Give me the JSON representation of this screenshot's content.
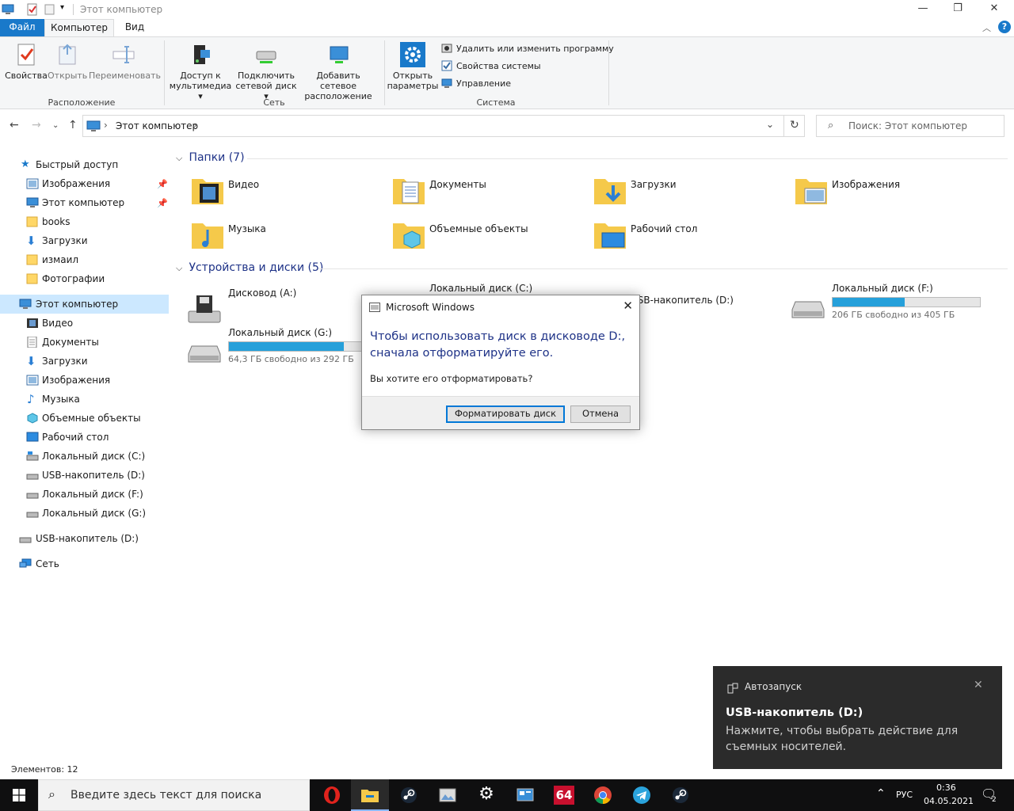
{
  "window": {
    "title": "Этот компьютер"
  },
  "ribbon": {
    "tabs": {
      "file": "Файл",
      "computer": "Компьютер",
      "view": "Вид"
    },
    "location": {
      "group_label": "Расположение",
      "properties": "Свойства",
      "open": "Открыть",
      "rename": "Переименовать"
    },
    "network": {
      "group_label": "Сеть",
      "media_line1": "Доступ к",
      "media_line2": "мультимедиа",
      "map_line1": "Подключить",
      "map_line2": "сетевой диск",
      "add_line1": "Добавить сетевое",
      "add_line2": "расположение"
    },
    "system": {
      "group_label": "Система",
      "open_line1": "Открыть",
      "open_line2": "параметры",
      "uninstall": "Удалить или изменить программу",
      "sysprops": "Свойства системы",
      "manage": "Управление"
    }
  },
  "nav": {
    "address": "Этот компьютер",
    "search_placeholder": "Поиск: Этот компьютер"
  },
  "sidebar": {
    "quick_access": "Быстрый доступ",
    "quick_items": [
      "Изображения",
      "Этот компьютер",
      "books",
      "Загрузки",
      "измаил",
      "Фотографии"
    ],
    "this_pc": "Этот компьютер",
    "pc_items": [
      "Видео",
      "Документы",
      "Загрузки",
      "Изображения",
      "Музыка",
      "Объемные объекты",
      "Рабочий стол",
      "Локальный диск (C:)",
      "USB-накопитель (D:)",
      "Локальный диск (F:)",
      "Локальный диск (G:)"
    ],
    "usb": "USB-накопитель (D:)",
    "network": "Сеть"
  },
  "content": {
    "folders_header": "Папки (7)",
    "folders": [
      "Видео",
      "Документы",
      "Загрузки",
      "Изображения",
      "Музыка",
      "Объемные объекты",
      "Рабочий стол"
    ],
    "drives_header": "Устройства и диски (5)",
    "drives": [
      {
        "name": "Дисковод (A:)"
      },
      {
        "name": "Локальный диск (C:)"
      },
      {
        "name": "USB-накопитель (D:)"
      },
      {
        "name": "Локальный диск (F:)",
        "free": "206 ГБ свободно из 405 ГБ",
        "used_fraction": 0.49
      },
      {
        "name": "Локальный диск (G:)",
        "free": "64,3 ГБ свободно из 292 ГБ",
        "used_fraction": 0.78
      }
    ]
  },
  "status": {
    "items": "Элементов: 12"
  },
  "dialog": {
    "title": "Microsoft Windows",
    "message": "Чтобы использовать диск в дисководе D:, сначала отформатируйте его.",
    "question": "Вы хотите его отформатировать?",
    "format_button": "Форматировать диск",
    "cancel_button": "Отмена"
  },
  "toast": {
    "app": "Автозапуск",
    "title": "USB-накопитель (D:)",
    "body": "Нажмите, чтобы выбрать действие для съемных носителей."
  },
  "taskbar": {
    "search_placeholder": "Введите здесь текст для поиска",
    "language": "РУС",
    "time": "0:36",
    "date": "04.05.2021",
    "notifications": "2",
    "aida_label": "64"
  },
  "colors": {
    "accent": "#1979ca",
    "progress": "#26a0da",
    "selected": "#cce8ff",
    "title_blue": "#1e3287"
  }
}
